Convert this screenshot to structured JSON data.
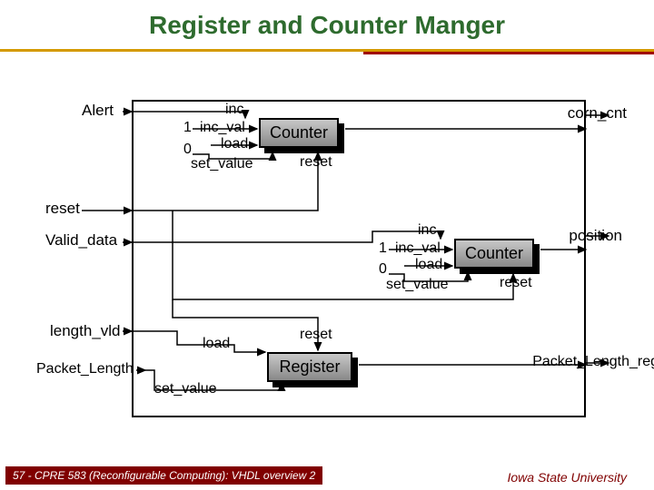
{
  "title": "Register and Counter Manger",
  "inputs": {
    "alert": "Alert",
    "reset": "reset",
    "valid_data": "Valid_data",
    "length_vld": "length_vld",
    "packet_length": "Packet_Length"
  },
  "outputs": {
    "corn_cnt": "corn_cnt",
    "position": "position",
    "packet_length_reg": "Packet_Length_reg"
  },
  "counter1": {
    "name": "Counter",
    "ports": {
      "inc": "inc",
      "inc_val": "inc_val",
      "load": "load",
      "set_value": "set_value",
      "reset": "reset"
    },
    "const1": "1",
    "const0": "0"
  },
  "counter2": {
    "name": "Counter",
    "ports": {
      "inc": "inc",
      "inc_val": "inc_val",
      "load": "load",
      "set_value": "set_value",
      "reset": "reset"
    },
    "const1": "1",
    "const0": "0"
  },
  "register": {
    "name": "Register",
    "ports": {
      "load": "load",
      "set_value": "set_value",
      "reset": "reset"
    }
  },
  "footer": {
    "left": "57 - CPRE 583 (Reconfigurable Computing): VHDL overview 2",
    "right": "Iowa State University"
  }
}
